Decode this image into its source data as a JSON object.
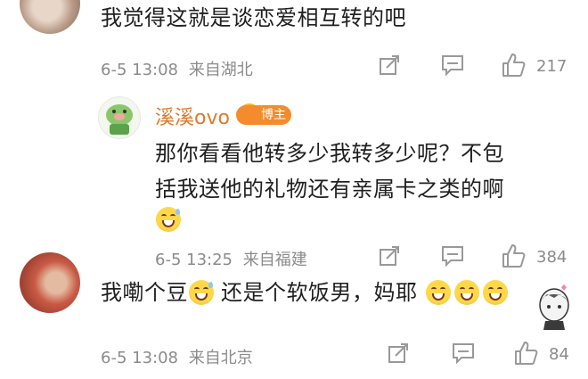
{
  "comment1": {
    "text": "我觉得这就是谈恋爱相互转的吧",
    "date": "6-5 13:08",
    "location": "来自湖北",
    "likes": "217"
  },
  "reply": {
    "name": "溪溪ovo",
    "badge": "博主",
    "text_line1": "那你看看他转多少我转多少呢？不包",
    "text_line2": "括我送他的礼物还有亲属卡之类的啊",
    "date": "6-5 13:25",
    "location": "来自福建",
    "likes": "384"
  },
  "comment2": {
    "text_part1": "我嘞个豆",
    "text_part2": "还是个软饭男，妈耶",
    "date": "6-5 13:08",
    "location": "来自北京",
    "likes": "84"
  },
  "icons": {
    "share": "share-icon",
    "comment": "comment-icon",
    "like": "thumbs-up-icon"
  },
  "colors": {
    "name": "#e07a2c",
    "badge": "#f28c2c",
    "meta": "#8b8b8b"
  }
}
